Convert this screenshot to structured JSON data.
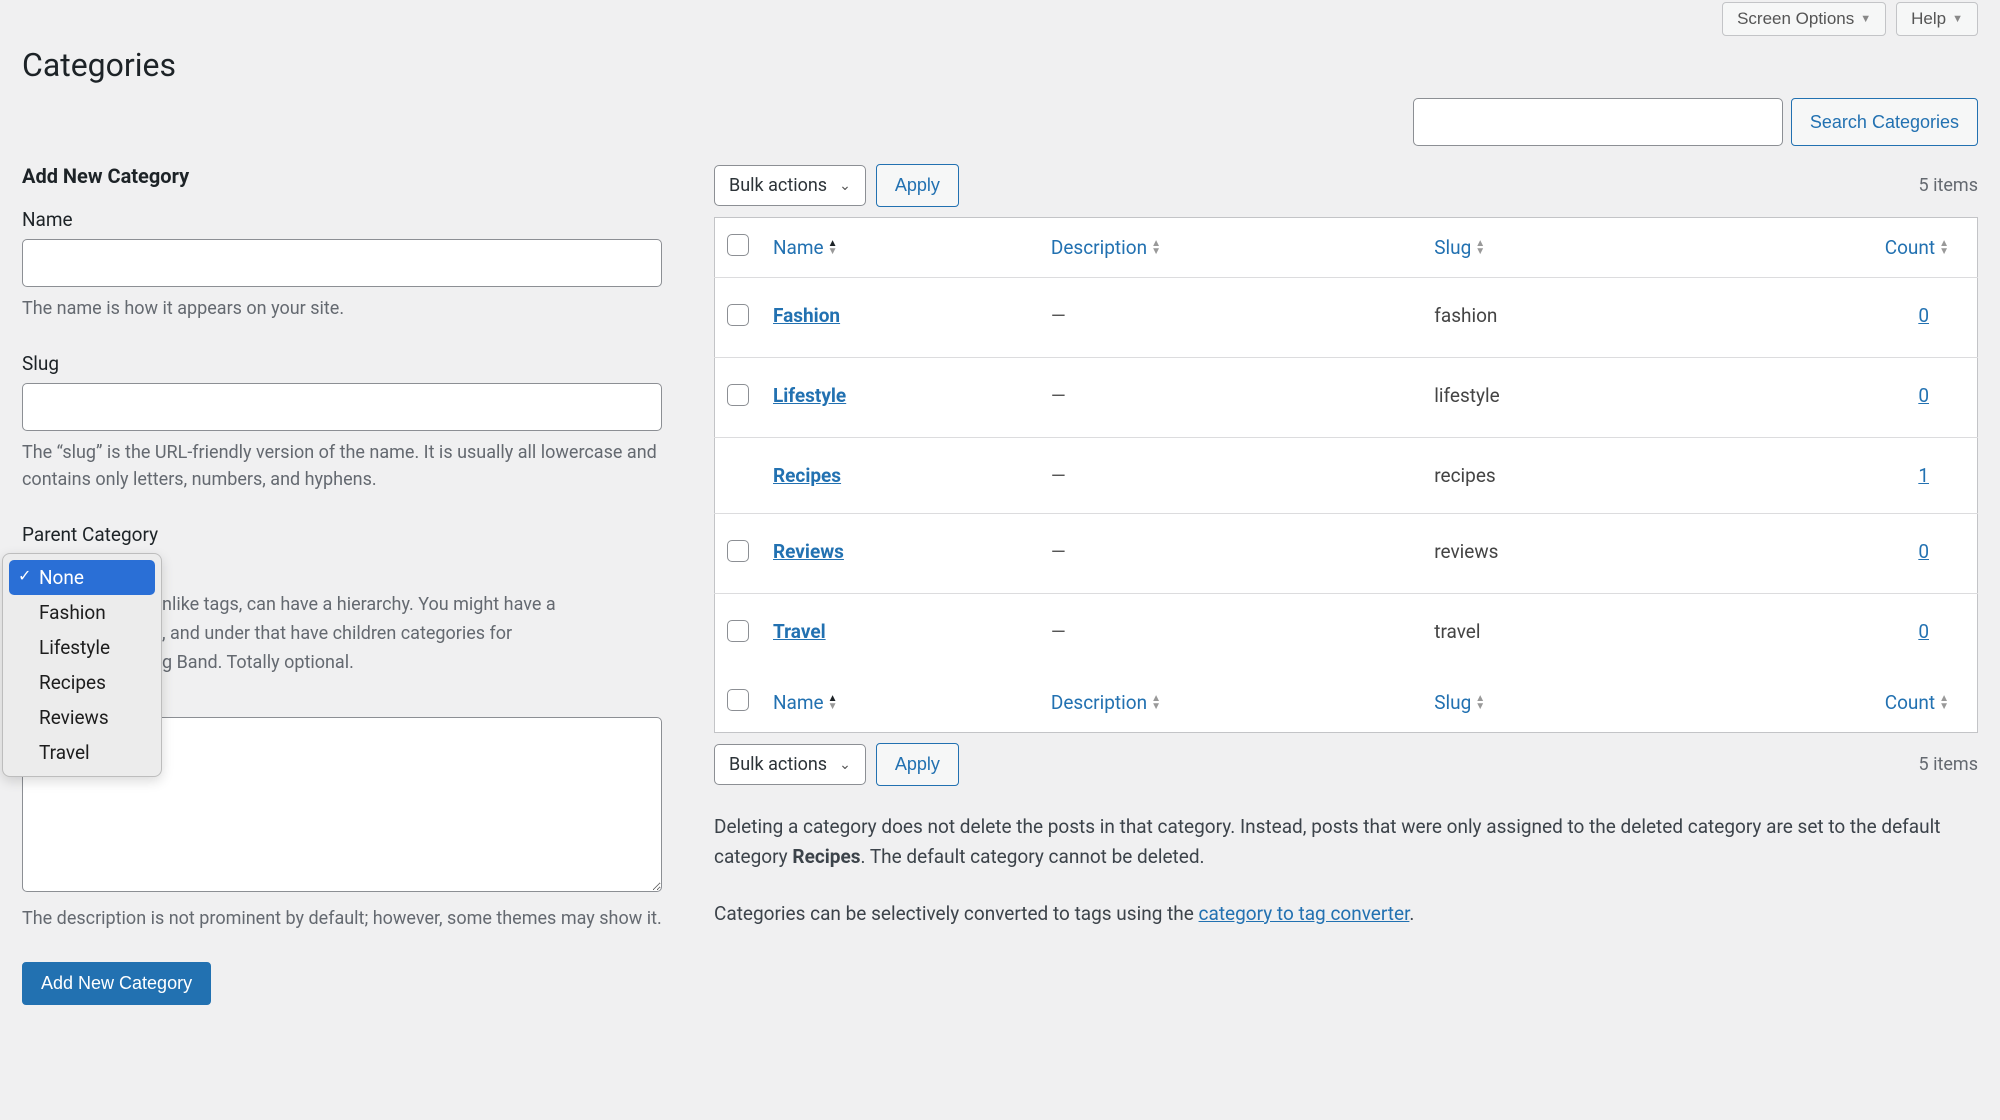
{
  "topbar": {
    "screen_options": "Screen Options",
    "help": "Help"
  },
  "page_title": "Categories",
  "search": {
    "button": "Search Categories"
  },
  "form": {
    "heading": "Add New Category",
    "name_label": "Name",
    "name_help": "The name is how it appears on your site.",
    "slug_label": "Slug",
    "slug_help": "The “slug” is the URL-friendly version of the name. It is usually all lowercase and contains only letters, numbers, and hyphens.",
    "parent_label": "Parent Category",
    "parent_options": [
      "None",
      "Fashion",
      "Lifestyle",
      "Recipes",
      "Reviews",
      "Travel"
    ],
    "parent_help_fragment_1": "nlike tags, can have a hierarchy. You might have a",
    "parent_help_fragment_2": ", and under that have children categories for",
    "parent_help_fragment_3": "g Band. Totally optional.",
    "desc_help": "The description is not prominent by default; however, some themes may show it.",
    "submit": "Add New Category"
  },
  "table": {
    "bulk_label": "Bulk actions",
    "apply": "Apply",
    "items_count": "5 items",
    "columns": {
      "name": "Name",
      "description": "Description",
      "slug": "Slug",
      "count": "Count"
    },
    "rows": [
      {
        "name": "Fashion",
        "description": "—",
        "slug": "fashion",
        "count": "0",
        "indent": false
      },
      {
        "name": "Lifestyle",
        "description": "—",
        "slug": "lifestyle",
        "count": "0",
        "indent": false
      },
      {
        "name": "Recipes",
        "description": "—",
        "slug": "recipes",
        "count": "1",
        "indent": true
      },
      {
        "name": "Reviews",
        "description": "—",
        "slug": "reviews",
        "count": "0",
        "indent": false
      },
      {
        "name": "Travel",
        "description": "—",
        "slug": "travel",
        "count": "0",
        "indent": false
      }
    ]
  },
  "notes": {
    "delete_prefix": "Deleting a category does not delete the posts in that category. Instead, posts that were only assigned to the deleted category are set to the default category ",
    "default_cat": "Recipes",
    "delete_suffix": ". The default category cannot be deleted.",
    "convert_prefix": "Categories can be selectively converted to tags using the ",
    "convert_link": "category to tag converter",
    "convert_suffix": "."
  }
}
